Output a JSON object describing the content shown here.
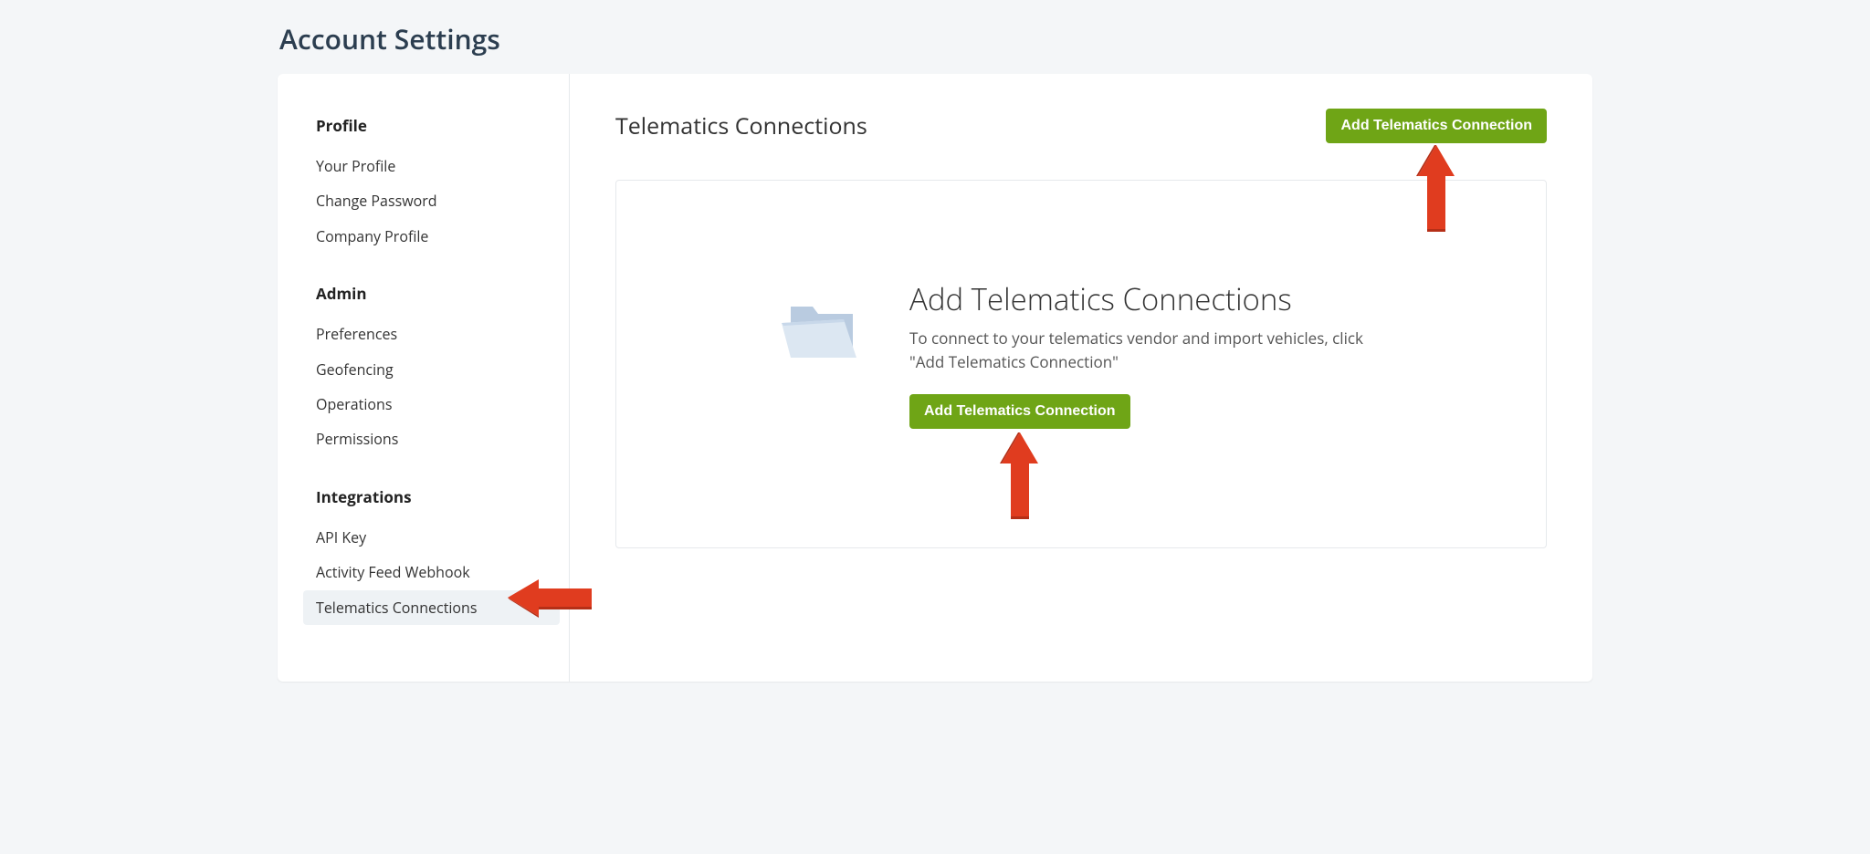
{
  "page": {
    "title": "Account Settings"
  },
  "sidebar": {
    "sections": [
      {
        "heading": "Profile",
        "items": [
          {
            "label": "Your Profile",
            "active": false
          },
          {
            "label": "Change Password",
            "active": false
          },
          {
            "label": "Company Profile",
            "active": false
          }
        ]
      },
      {
        "heading": "Admin",
        "items": [
          {
            "label": "Preferences",
            "active": false
          },
          {
            "label": "Geofencing",
            "active": false
          },
          {
            "label": "Operations",
            "active": false
          },
          {
            "label": "Permissions",
            "active": false
          }
        ]
      },
      {
        "heading": "Integrations",
        "items": [
          {
            "label": "API Key",
            "active": false
          },
          {
            "label": "Activity Feed Webhook",
            "active": false
          },
          {
            "label": "Telematics Connections",
            "active": true
          }
        ]
      }
    ]
  },
  "main": {
    "heading": "Telematics Connections",
    "top_button": "Add Telematics Connection",
    "empty": {
      "title": "Add Telematics Connections",
      "description": "To connect to your telematics vendor and import vehicles, click \"Add Telematics Connection\"",
      "button": "Add Telematics Connection"
    }
  },
  "colors": {
    "primary": "#6fa516",
    "arrow": "#e03c1f"
  }
}
